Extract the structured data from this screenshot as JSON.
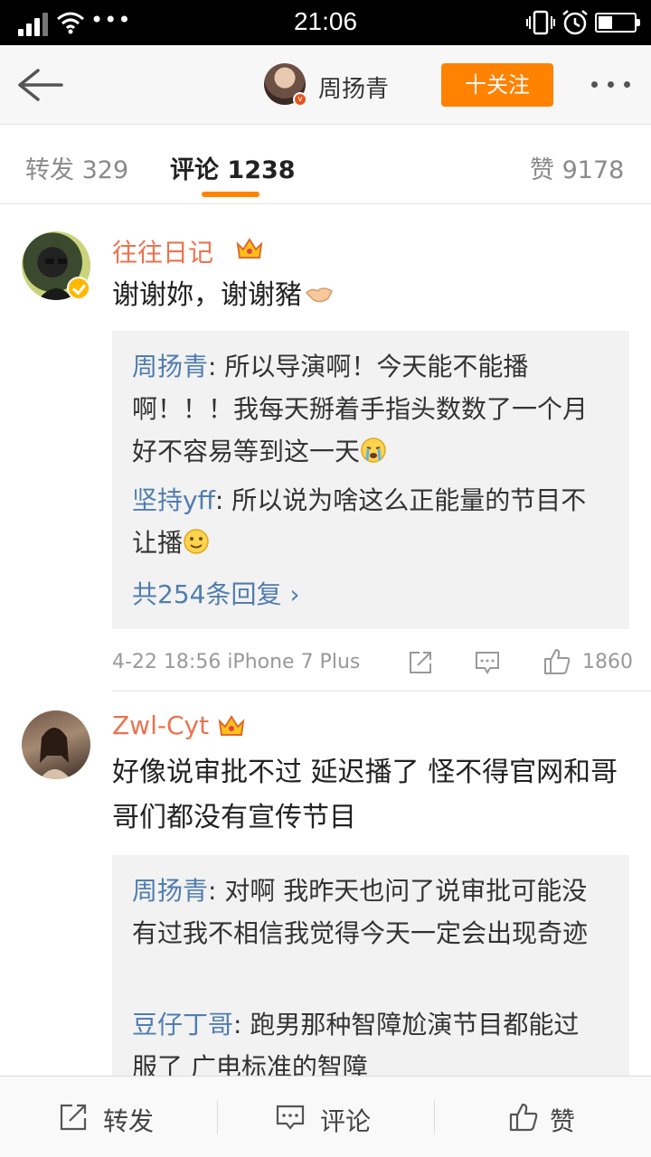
{
  "status_bar": {
    "time": "21:06",
    "overflow_dots": "•••",
    "battery_level_fraction": 0.4
  },
  "header": {
    "user_name": "周扬青",
    "follow_label": "十关注"
  },
  "tabs": {
    "repost": {
      "label": "转发",
      "count": "329"
    },
    "comment": {
      "label": "评论",
      "count": "1238"
    },
    "like": {
      "label": "赞",
      "count": "9178"
    }
  },
  "comments": [
    {
      "name": "往往日记",
      "text": "谢谢妳，谢谢豬",
      "replies": [
        {
          "name": "周扬青",
          "text": ": 所以导演啊！今天能不能播啊！！！我每天掰着手指头数数了一个月好不容易等到这一天"
        },
        {
          "name": "坚持yff",
          "text": ": 所以说为啥这么正能量的节目不让播"
        }
      ],
      "more_replies": "共254条回复 ›",
      "meta": "4-22 18:56  iPhone 7 Plus",
      "likes": "1860"
    },
    {
      "name": "Zwl-Cyt",
      "text": "好像说审批不过 延迟播了 怪不得官网和哥哥们都没有宣传节目",
      "replies": [
        {
          "name": "周扬青",
          "text": ": 对啊 我昨天也问了说审批可能没有过我不相信我觉得今天一定会出现奇迹"
        },
        {
          "name": "豆仔丁哥",
          "text": ": 跑男那种智障尬演节目都能过 服了 广电标准的智障"
        }
      ]
    }
  ],
  "toolbar": {
    "repost": "转发",
    "comment": "评论",
    "like": "赞"
  },
  "colors": {
    "accent": "#ff8200",
    "username": "#eb7350",
    "link": "#507daf"
  }
}
